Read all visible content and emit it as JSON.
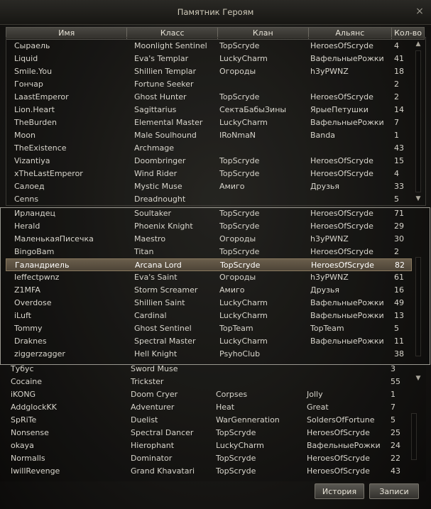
{
  "window": {
    "title": "Памятник Героям",
    "close_icon": "×"
  },
  "columns": [
    "Имя",
    "Класс",
    "Клан",
    "Альянс",
    "Кол-во"
  ],
  "rows": [
    [
      "Сыраель",
      "Moonlight Sentinel",
      "TopScryde",
      "HeroesOfScryde",
      "4"
    ],
    [
      "Liquid",
      "Eva's Templar",
      "LuckyCharm",
      "ВафельныеРожки",
      "41"
    ],
    [
      "Smile.You",
      "Shillien Templar",
      "Огороды",
      "h3yPWNZ",
      "18"
    ],
    [
      "Гончар",
      "Fortune Seeker",
      "",
      "",
      "2"
    ],
    [
      "LaastEmperor",
      "Ghost Hunter",
      "TopScryde",
      "HeroesOfScryde",
      "2"
    ],
    [
      "Lion.Heart",
      "Sagittarius",
      "СектаБабыЗины",
      "ЯрыеПетушки",
      "14"
    ],
    [
      "TheBurden",
      "Elemental Master",
      "LuckyCharm",
      "ВафельныеРожки",
      "7"
    ],
    [
      "Moon",
      "Male Soulhound",
      "IRoNmaN",
      "Banda",
      "1"
    ],
    [
      "TheExistence",
      "Archmage",
      "",
      "",
      "43"
    ],
    [
      "Vizantiya",
      "Doombringer",
      "TopScryde",
      "HeroesOfScryde",
      "15"
    ],
    [
      "xTheLastEmperor",
      "Wind Rider",
      "TopScryde",
      "HeroesOfScryde",
      "4"
    ],
    [
      "Салоед",
      "Mystic Muse",
      "Амиго",
      "Друзья",
      "33"
    ],
    [
      "Cenns",
      "Dreadnought",
      "",
      "",
      "5"
    ],
    [
      "Ирландец",
      "Soultaker",
      "TopScryde",
      "HeroesOfScryde",
      "71"
    ],
    [
      "Herald",
      "Phoenix Knight",
      "TopScryde",
      "HeroesOfScryde",
      "29"
    ],
    [
      "МаленькаяПисечка",
      "Maestro",
      "Огороды",
      "h3yPWNZ",
      "30"
    ],
    [
      "BingoBam",
      "Titan",
      "TopScryde",
      "HeroesOfScryde",
      "2"
    ],
    [
      "Галандриель",
      "Arcana Lord",
      "TopScryde",
      "HeroesOfScryde",
      "82"
    ],
    [
      "Ieffectpwnz",
      "Eva's Saint",
      "Огороды",
      "h3yPWNZ",
      "61"
    ],
    [
      "Z1MFA",
      "Storm Screamer",
      "Амиго",
      "Друзья",
      "16"
    ],
    [
      "Overdose",
      "Shillien Saint",
      "LuckyCharm",
      "ВафельныеРожки",
      "49"
    ],
    [
      "iLuft",
      "Cardinal",
      "LuckyCharm",
      "ВафельныеРожки",
      "13"
    ],
    [
      "Tommy",
      "Ghost Sentinel",
      "TopTeam",
      "TopTeam",
      "5"
    ],
    [
      "Draknes",
      "Spectral Master",
      "LuckyCharm",
      "ВафельныеРожки",
      "11"
    ],
    [
      "ziggerzagger",
      "Hell Knight",
      "PsyhoClub",
      "",
      "38"
    ],
    [
      "Тубус",
      "Sword Muse",
      "",
      "",
      "3"
    ],
    [
      "Cocaine",
      "Trickster",
      "",
      "",
      "55"
    ],
    [
      "iKONG",
      "Doom Cryer",
      "Corpses",
      "Jolly",
      "1"
    ],
    [
      "AddglockKK",
      "Adventurer",
      "Heat",
      "Great",
      "7"
    ],
    [
      "SpRiTe",
      "Duelist",
      "WarGenneration",
      "SoldersOfFortune",
      "5"
    ],
    [
      "Nonsense",
      "Spectral Dancer",
      "TopScryde",
      "HeroesOfScryde",
      "25"
    ],
    [
      "okaya",
      "Hierophant",
      "LuckyCharm",
      "ВафельныеРожки",
      "24"
    ],
    [
      "Normalls",
      "Dominator",
      "TopScryde",
      "HeroesOfScryde",
      "22"
    ],
    [
      "IwillRevenge",
      "Grand Khavatari",
      "TopScryde",
      "HeroesOfScryde",
      "43"
    ]
  ],
  "selected_row": 17,
  "buttons": {
    "history": "История",
    "records": "Записи"
  },
  "colors": {
    "selected_bg": "#5c5242",
    "text": "#d8d5cc",
    "background": "#151412"
  }
}
